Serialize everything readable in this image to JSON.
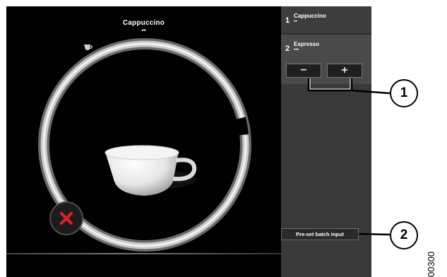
{
  "main": {
    "title": "Cappuccino",
    "strength": "**"
  },
  "sidebar": {
    "items": [
      {
        "number": "1",
        "name": "Cappuccino",
        "strength": "**"
      },
      {
        "number": "2",
        "name": "Espresso",
        "strength": "***"
      }
    ],
    "minus_label": "−",
    "plus_label": "+",
    "preset_label": "Pre-set batch input"
  },
  "callouts": {
    "one": "1",
    "two": "2"
  },
  "document_id": "00300",
  "icons": {
    "progress": "progress-ring-icon",
    "cup": "cappuccino-cup-icon",
    "cancel": "cancel-x-icon",
    "small_cup": "cup-icon"
  },
  "colors": {
    "screen_bg": "#000000",
    "sidebar_bg": "#393939",
    "selected_item_bg": "#4a4a4a",
    "cancel_accent": "#e2202b"
  }
}
